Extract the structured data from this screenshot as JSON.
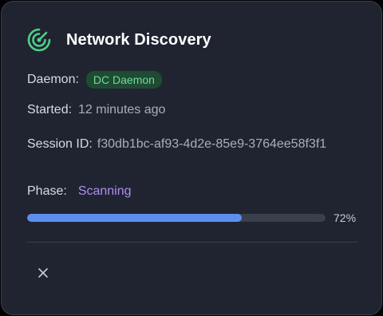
{
  "title": "Network Discovery",
  "daemon": {
    "label": "Daemon:",
    "value": "DC Daemon"
  },
  "started": {
    "label": "Started:",
    "value": "12 minutes ago"
  },
  "session": {
    "label": "Session ID:",
    "value": "f30db1bc-af93-4d2e-85e9-3764ee58f3f1"
  },
  "phase": {
    "label": "Phase:",
    "value": "Scanning"
  },
  "progress": {
    "percent": 72,
    "text": "72%"
  },
  "icons": {
    "header": "radar-icon",
    "close": "close-icon"
  },
  "colors": {
    "accent_green": "#4fd08a",
    "badge_bg": "#1f4a34",
    "phase_purple": "#b28bf5",
    "progress_blue": "#5b8ff0"
  }
}
